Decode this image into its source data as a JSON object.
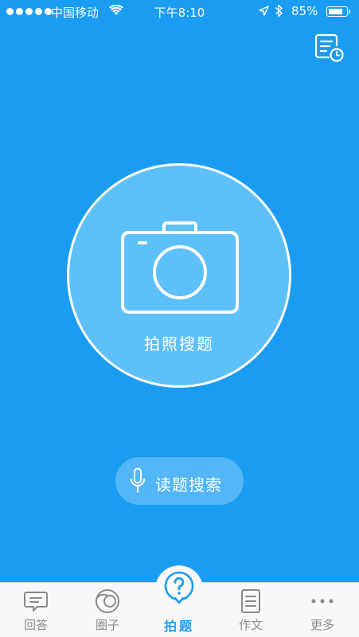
{
  "status_bar": {
    "carrier": "中国移动",
    "time": "下午8:10",
    "battery_percent": "85%",
    "battery_level": 0.85
  },
  "header": {
    "history_icon": "history-list-icon"
  },
  "main": {
    "camera_label": "拍照搜题",
    "camera_icon": "camera-icon",
    "voice_label": "读题搜索",
    "voice_icon": "microphone-icon"
  },
  "tab_bar": {
    "items": [
      {
        "label": "回答",
        "icon": "chat-bubble-icon"
      },
      {
        "label": "圈子",
        "icon": "circles-icon"
      },
      {
        "label": "拍题",
        "icon": "question-bubble-icon"
      },
      {
        "label": "作文",
        "icon": "document-icon"
      },
      {
        "label": "更多",
        "icon": "more-dots-icon"
      }
    ]
  },
  "colors": {
    "background": "#1a9cf2",
    "circle": "#5ec0f9",
    "tab_active": "#1a9cf2",
    "tab_inactive": "#8a8a8a"
  }
}
